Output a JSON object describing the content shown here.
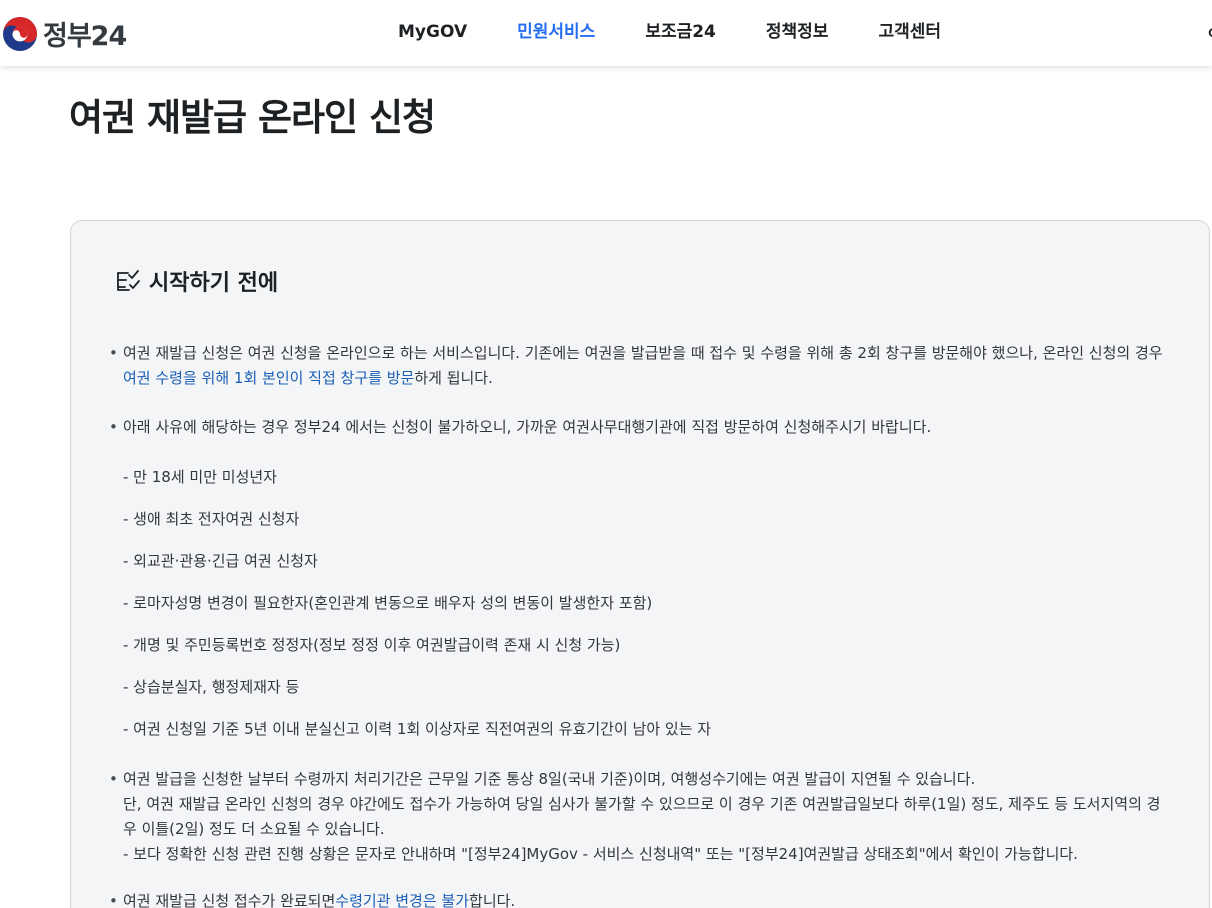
{
  "header": {
    "logo": {
      "icon": "taegeuk-emblem-icon",
      "text": "정부24"
    },
    "nav": [
      {
        "label": "MyGOV",
        "active": false
      },
      {
        "label": "민원서비스",
        "active": true
      },
      {
        "label": "보조금24",
        "active": false
      },
      {
        "label": "정책정보",
        "active": false
      },
      {
        "label": "고객센터",
        "active": false
      }
    ],
    "edge_fragment": "ㅇ"
  },
  "page": {
    "title": "여권 재발급 온라인 신청"
  },
  "notice": {
    "icon": "checklist-icon",
    "title": "시작하기 전에",
    "item1": {
      "text_a": "여권 재발급 신청은 여권 신청을 온라인으로 하는 서비스입니다. 기존에는 여권을 발급받을 때 접수 및 수령을 위해 총 2회 창구를 방문해야 했으나, 온라인 신청의 경우 ",
      "highlight": "여권 수령을 위해 1회 본인이 직접 창구를 방문",
      "text_b": "하게 됩니다."
    },
    "item2": {
      "text": "아래 사유에 해당하는 경우 정부24 에서는 신청이 불가하오니, 가까운 여권사무대행기관에 직접 방문하여 신청해주시기 바랍니다.",
      "subitems": [
        "- 만 18세 미만 미성년자",
        "- 생애 최초 전자여권 신청자",
        "- 외교관·관용·긴급 여권 신청자",
        "- 로마자성명 변경이 필요한자(혼인관계 변동으로 배우자 성의 변동이 발생한자 포함)",
        "- 개명 및 주민등록번호 정정자(정보 정정 이후 여권발급이력 존재 시 신청 가능)",
        "- 상습분실자, 행정제재자 등",
        "- 여권 신청일 기준 5년 이내 분실신고 이력 1회 이상자로 직전여권의 유효기간이 남아 있는 자"
      ]
    },
    "item3": {
      "line1": "여권 발급을 신청한 날부터 수령까지 처리기간은 근무일 기준 통상 8일(국내 기준)이며, 여행성수기에는 여권 발급이 지연될 수 있습니다.",
      "line2": "단, 여권 재발급 온라인 신청의 경우 야간에도 접수가 가능하여 당일 심사가 불가할 수 있으므로 이 경우 기존 여권발급일보다 하루(1일) 정도, 제주도 등 도서지역의 경우 이틀(2일) 정도 더 소요될 수 있습니다.",
      "line3": "- 보다 정확한 신청 관련 진행 상황은 문자로 안내하며 \"[정부24]MyGov - 서비스 신청내역\" 또는 \"[정부24]여권발급 상태조회\"에서 확인이 가능합니다."
    },
    "item4": {
      "text_a": "여권 재발급 신청 접수가 완료되면",
      "highlight": "수령기관 변경은 불가",
      "text_b": "합니다."
    }
  },
  "colors": {
    "accent": "#256ef4",
    "highlight_text": "#1b5fb7",
    "panel_bg": "#f4f5f6",
    "panel_border": "#d4d6d9"
  }
}
